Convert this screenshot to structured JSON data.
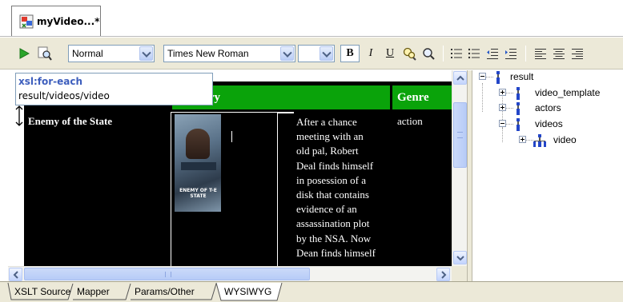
{
  "document_tab": {
    "title": "myVideo...*"
  },
  "toolbar": {
    "style_combo": "Normal",
    "font_combo": "Times New Roman",
    "size_combo": "",
    "bold": "B",
    "italic": "I",
    "underline": "U"
  },
  "tooltip": {
    "element": "xsl:for-each",
    "path": "result/videos/video"
  },
  "table": {
    "headers": [
      "nary",
      "Genre"
    ],
    "row": {
      "title": "Enemy of the State",
      "poster_caption": "ENEMY OF T-E STATE",
      "description_lines": [
        "After a chance",
        "meeting with an",
        "old pal, Robert",
        "Deal finds himself",
        "in posession of a",
        "disk that contains",
        "evidence of an",
        "assassination plot",
        "by the NSA. Now",
        "Dean finds himself"
      ],
      "genre": "action"
    }
  },
  "tree": {
    "nodes": [
      {
        "label": "result"
      },
      {
        "label": "video_template"
      },
      {
        "label": "actors"
      },
      {
        "label": "videos"
      },
      {
        "label": "video"
      }
    ]
  },
  "view_tabs": [
    "XSLT Source",
    "Mapper",
    "Params/Other",
    "WYSIWYG"
  ],
  "colors": {
    "header_green": "#0aa30a",
    "table_black": "#000000",
    "tooltip_blue": "#3d5ebd"
  }
}
